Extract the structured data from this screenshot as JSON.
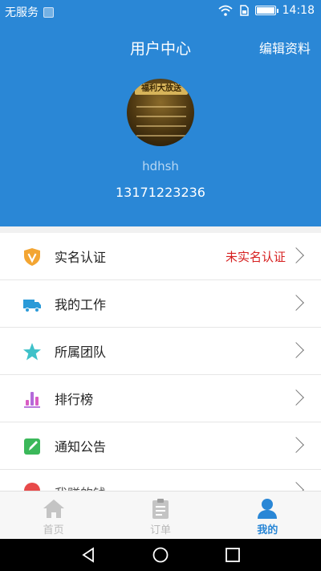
{
  "status_bar": {
    "carrier": "无服务",
    "time": "14:18"
  },
  "header": {
    "title": "用户中心",
    "edit_label": "编辑资料",
    "avatar_banner_text": "福利大放送",
    "username": "hdhsh",
    "phone": "13171223236"
  },
  "menu": {
    "items": [
      {
        "label": "实名认证",
        "icon": "shield-v-icon",
        "status": "未实名认证"
      },
      {
        "label": "我的工作",
        "icon": "truck-icon"
      },
      {
        "label": "所属团队",
        "icon": "star-icon"
      },
      {
        "label": "排行榜",
        "icon": "ranking-icon"
      },
      {
        "label": "通知公告",
        "icon": "notice-icon"
      },
      {
        "label": "我赚的钱",
        "icon": "money-icon"
      }
    ]
  },
  "tabs": [
    {
      "label": "首页",
      "icon": "home-icon",
      "active": false
    },
    {
      "label": "订单",
      "icon": "clipboard-icon",
      "active": false
    },
    {
      "label": "我的",
      "icon": "person-icon",
      "active": true
    }
  ],
  "colors": {
    "primary": "#2a87d6",
    "warning_text": "#d61f1f",
    "inactive_tab": "#b9b9b9"
  }
}
